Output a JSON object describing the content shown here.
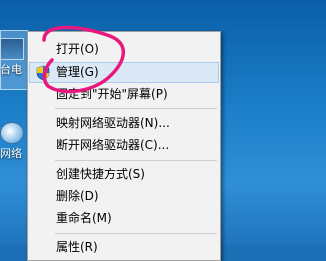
{
  "menu": {
    "items": [
      {
        "label": "打开(O)"
      },
      {
        "label": "管理(G)"
      },
      {
        "label": "固定到\"开始\"屏幕(P)"
      },
      {
        "label": "映射网络驱动器(N)..."
      },
      {
        "label": "断开网络驱动器(C)..."
      },
      {
        "label": "创建快捷方式(S)"
      },
      {
        "label": "删除(D)"
      },
      {
        "label": "重命名(M)"
      },
      {
        "label": "属性(R)"
      }
    ],
    "highlighted_item": "管理(G)",
    "icons": {
      "manage": "uac-shield-icon"
    }
  },
  "desktop": {
    "icons": [
      {
        "label": "台电",
        "icon": "computer-icon"
      },
      {
        "label": "网络",
        "icon": "network-icon"
      }
    ]
  },
  "colors": {
    "desktop_background": "#1c7fc9",
    "menu_background": "#f2f2f2",
    "highlight": "#dbe9f7",
    "annotation_stroke": "#e8187f"
  }
}
